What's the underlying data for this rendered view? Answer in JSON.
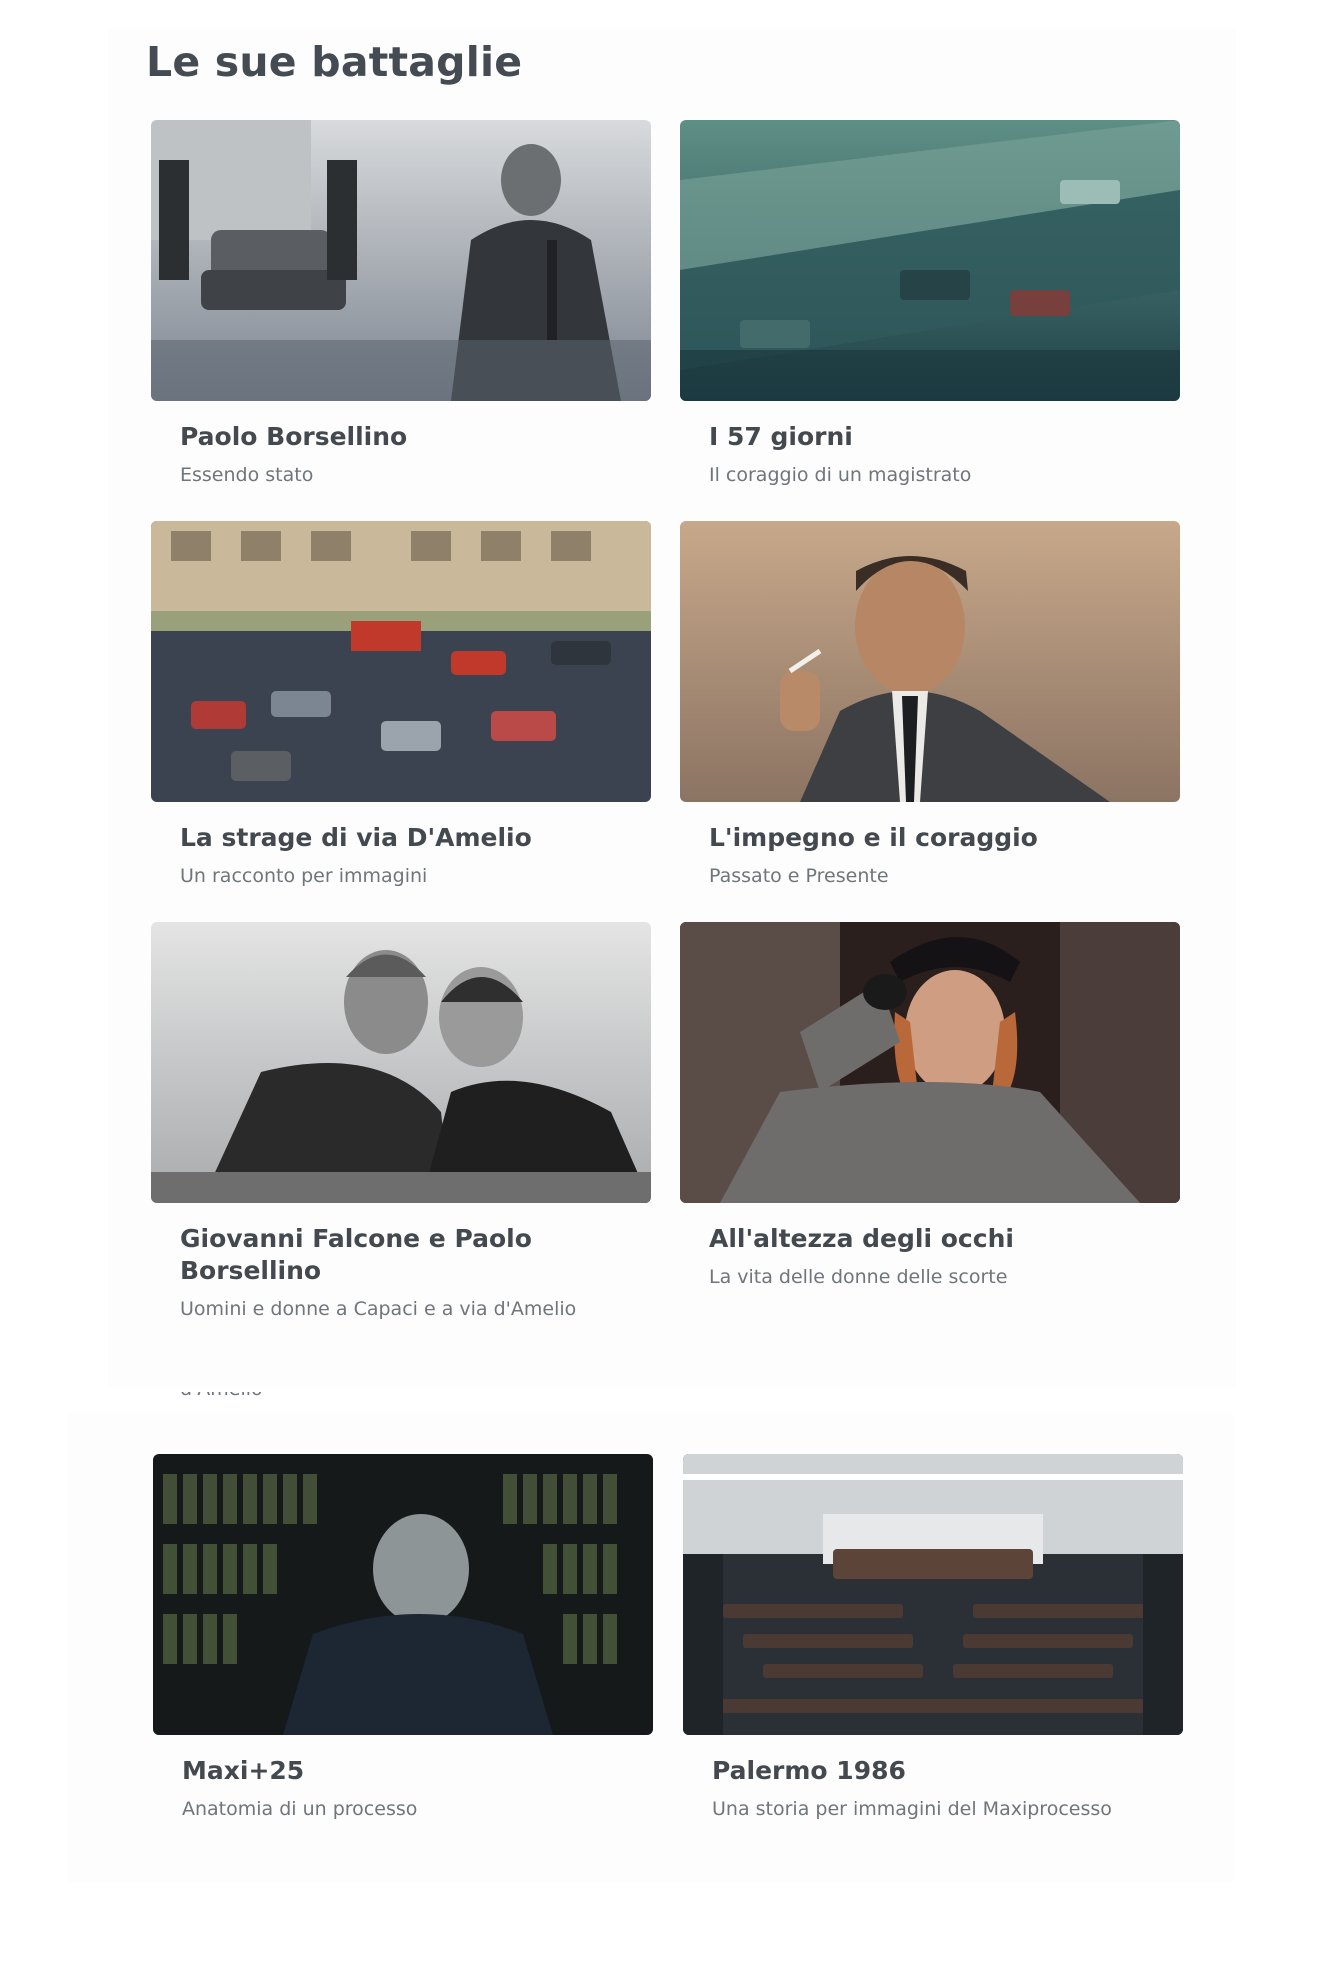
{
  "section": {
    "title": "Le sue battaglie"
  },
  "cards": [
    {
      "title": "Paolo Borsellino",
      "subtitle": "Essendo stato",
      "image": "photo-borsellino-carabinieri"
    },
    {
      "title": "I 57 giorni",
      "subtitle": "Il coraggio di un magistrato",
      "image": "photo-aerial-via-damelio"
    },
    {
      "title": "La strage di via D'Amelio",
      "subtitle": "Un racconto per immagini",
      "image": "photo-via-damelio-aftermath"
    },
    {
      "title": "L'impegno e il coraggio",
      "subtitle": "Passato e Presente",
      "image": "photo-borsellino-portrait"
    },
    {
      "title": "Giovanni Falcone e Paolo Borsellino",
      "subtitle": "Uomini e donne a Capaci e a via d'Amelio",
      "image": "photo-falcone-borsellino"
    },
    {
      "title": "All'altezza degli occhi",
      "subtitle": "La vita delle donne delle scorte",
      "image": "photo-policewoman-salute"
    },
    {
      "title": "Maxi+25",
      "subtitle": "Anatomia di un processo",
      "image": "photo-archive-files"
    },
    {
      "title": "Palermo 1986",
      "subtitle": "Una storia per immagini del Maxiprocesso",
      "image": "photo-bunker-courtroom"
    }
  ],
  "ghost_text": "d'Amelio"
}
